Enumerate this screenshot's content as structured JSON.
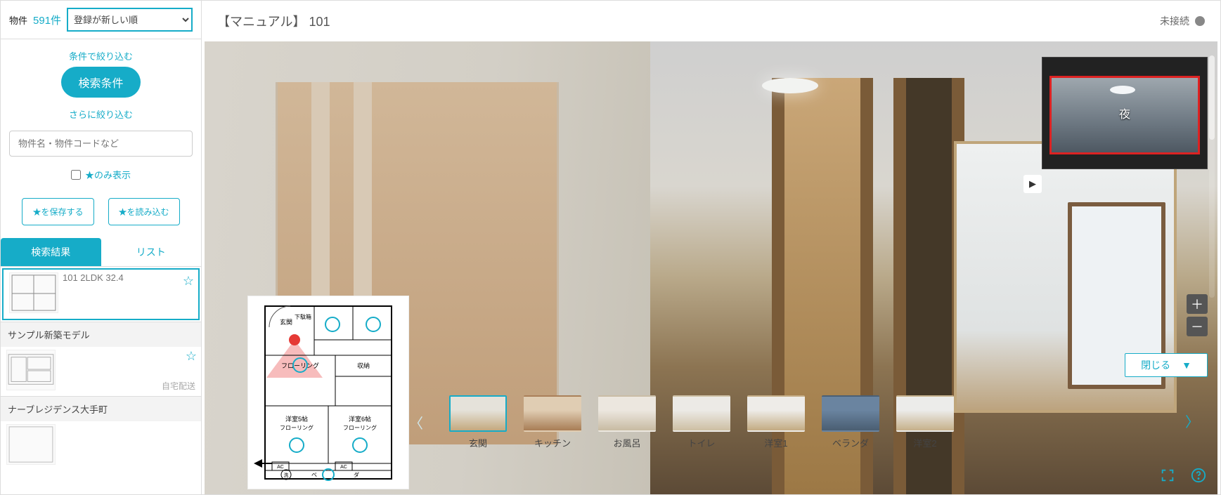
{
  "sidebar": {
    "title_label": "物件",
    "count": "591件",
    "sort_options": [
      "登録が新しい順"
    ],
    "sort_selected": "登録が新しい順",
    "filter_link": "条件で絞り込む",
    "search_conditions_btn": "検索条件",
    "refine_link": "さらに絞り込む",
    "search_placeholder": "物件名・物件コードなど",
    "star_only_label": "★のみ表示",
    "save_btn": "★を保存する",
    "load_btn": "★を読み込む",
    "tab_results": "検索結果",
    "tab_list": "リスト",
    "items": [
      {
        "title": "101 2LDK 32.4",
        "subtext": "",
        "starred": false
      },
      {
        "title": "サンプル新築モデル",
        "subtext": "自宅配送",
        "starred": false
      },
      {
        "title": "ナーブレジデンス大手町",
        "subtext": "",
        "starred": false
      }
    ]
  },
  "main": {
    "title": "【マニュアル】 101",
    "connection": "未接続",
    "overlay_thumb_label": "夜",
    "close_label": "閉じる",
    "thumbs": [
      {
        "label": "玄関",
        "active": true
      },
      {
        "label": "キッチン",
        "active": false
      },
      {
        "label": "お風呂",
        "active": false
      },
      {
        "label": "トイレ",
        "active": false
      },
      {
        "label": "洋室1",
        "active": false
      },
      {
        "label": "ベランダ",
        "active": false
      },
      {
        "label": "洋室2",
        "active": false
      }
    ]
  }
}
